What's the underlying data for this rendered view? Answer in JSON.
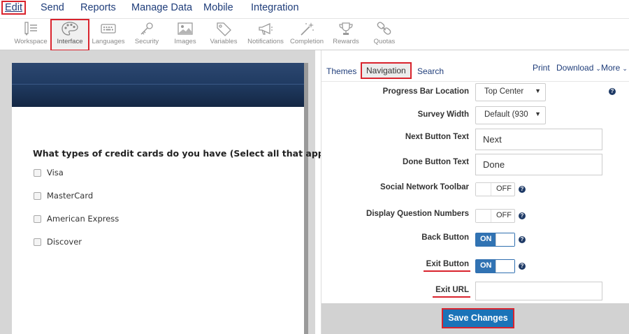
{
  "menu": {
    "items": [
      {
        "label": "Edit",
        "active": true
      },
      {
        "label": "Send"
      },
      {
        "label": "Reports"
      },
      {
        "label": "Manage Data"
      },
      {
        "label": "Mobile"
      },
      {
        "label": "Integration"
      }
    ]
  },
  "toolbar": {
    "items": [
      {
        "label": "Workspace",
        "icon": "workspace-icon"
      },
      {
        "label": "Interface",
        "icon": "palette-icon",
        "active": true
      },
      {
        "label": "Languages",
        "icon": "keyboard-icon"
      },
      {
        "label": "Security",
        "icon": "key-icon"
      },
      {
        "label": "Images",
        "icon": "image-icon"
      },
      {
        "label": "Variables",
        "icon": "tag-icon"
      },
      {
        "label": "Notifications",
        "icon": "megaphone-icon"
      },
      {
        "label": "Completion",
        "icon": "magic-wand-icon"
      },
      {
        "label": "Rewards",
        "icon": "trophy-icon"
      },
      {
        "label": "Quotas",
        "icon": "chain-icon"
      }
    ]
  },
  "preview": {
    "question": "What types of credit cards do you have (Select all that apply)?",
    "options": [
      "Visa",
      "MasterCard",
      "American Express",
      "Discover"
    ]
  },
  "panel": {
    "tabs": [
      {
        "label": "Themes"
      },
      {
        "label": "Navigation",
        "active": true
      },
      {
        "label": "Search"
      }
    ],
    "links": {
      "print": "Print",
      "download": "Download",
      "more": "More"
    },
    "fields": {
      "progress_bar_location": {
        "label": "Progress Bar Location",
        "value": "Top Center"
      },
      "survey_width": {
        "label": "Survey Width",
        "value": "Default (930"
      },
      "next_button_text": {
        "label": "Next Button Text",
        "value": "Next"
      },
      "done_button_text": {
        "label": "Done Button Text",
        "value": "Done"
      },
      "social_network_toolbar": {
        "label": "Social Network Toolbar",
        "state": "OFF"
      },
      "display_question_numbers": {
        "label": "Display Question Numbers",
        "state": "OFF"
      },
      "back_button": {
        "label": "Back Button",
        "state": "ON"
      },
      "exit_button": {
        "label": "Exit Button",
        "state": "ON"
      },
      "exit_url": {
        "label": "Exit URL",
        "value": ""
      }
    },
    "help_glyph": "?",
    "save_label": "Save Changes"
  },
  "colors": {
    "accent_blue": "#1a73b8",
    "highlight_red": "#d9232d",
    "nav_text": "#1f3d7a",
    "header_navy": "#213c63"
  }
}
